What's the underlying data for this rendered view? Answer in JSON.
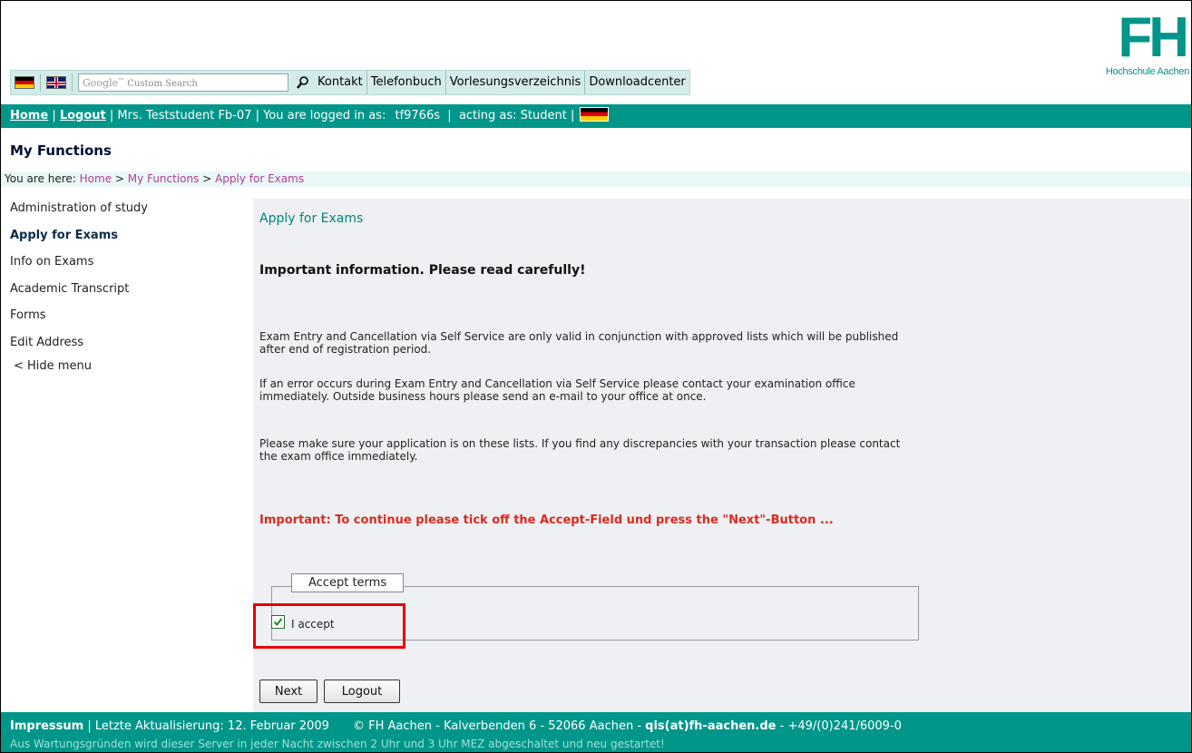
{
  "topbar": {
    "search_placeholder_brand": "Google",
    "search_placeholder_tm": "™",
    "search_placeholder_text": " Custom Search",
    "nav": [
      "Kontakt",
      "Telefonbuch",
      "Vorlesungsverzeichnis",
      "Downloadcenter"
    ]
  },
  "logo": {
    "big": "FH",
    "sub": "Hochschule Aachen"
  },
  "userbar": {
    "home": "Home",
    "logout": "Logout",
    "user": "Mrs. Teststudent Fb-07",
    "logged_in_prefix": "You are logged in as:",
    "login_id": "tf9766s",
    "acting_as": "acting as: Student"
  },
  "section_title": "My Functions",
  "breadcrumb": {
    "prefix": "You are here:",
    "home": "Home",
    "my_functions": "My Functions",
    "current": "Apply for Exams",
    "separator": ">"
  },
  "sidebar": {
    "items": [
      {
        "label": "Administration of study",
        "active": false
      },
      {
        "label": "Apply for Exams",
        "active": true
      },
      {
        "label": "Info on Exams",
        "active": false
      },
      {
        "label": "Academic Transcript",
        "active": false
      },
      {
        "label": "Forms",
        "active": false
      },
      {
        "label": "Edit Address",
        "active": false
      }
    ],
    "hide_menu": "< Hide menu"
  },
  "main": {
    "title": "Apply for Exams",
    "important_head": "Important information. Please read carefully!",
    "p1": "Exam Entry and Cancellation via Self Service are only valid in conjunction with approved lists which will be published after end of registration period.",
    "p2": "If an error occurs during Exam Entry and Cancellation via Self Service please contact your examination office immediately. Outside business hours please send an e-mail to your office at once.",
    "p3": "Please make sure your application is on these lists. If you find any discrepancies with your transaction please contact the exam office immediately.",
    "warning": "Important: To continue please tick off the Accept-Field und press the \"Next\"-Button ...",
    "legend": "Accept terms",
    "accept_label": "I accept",
    "accept_checked": true,
    "next_label": "Next",
    "logout_label": "Logout"
  },
  "footer": {
    "impressum": "Impressum",
    "updated": "| Letzte Aktualisierung: 12. Februar 2009",
    "address": "© FH Aachen - Kalverbenden 6 - 52066 Aachen -",
    "email": "qis(at)fh-aachen.de",
    "phone": "- +49/(0)241/6009-0",
    "maintenance": "Aus Wartungsgründen wird dieser Server in jeder Nacht zwischen 2 Uhr und 3 Uhr MEZ abgeschaltet und neu gestartet!"
  },
  "colors": {
    "brand_teal": "#00968a",
    "warning_red": "#dd2a1f",
    "link_magenta": "#b43c9a"
  }
}
